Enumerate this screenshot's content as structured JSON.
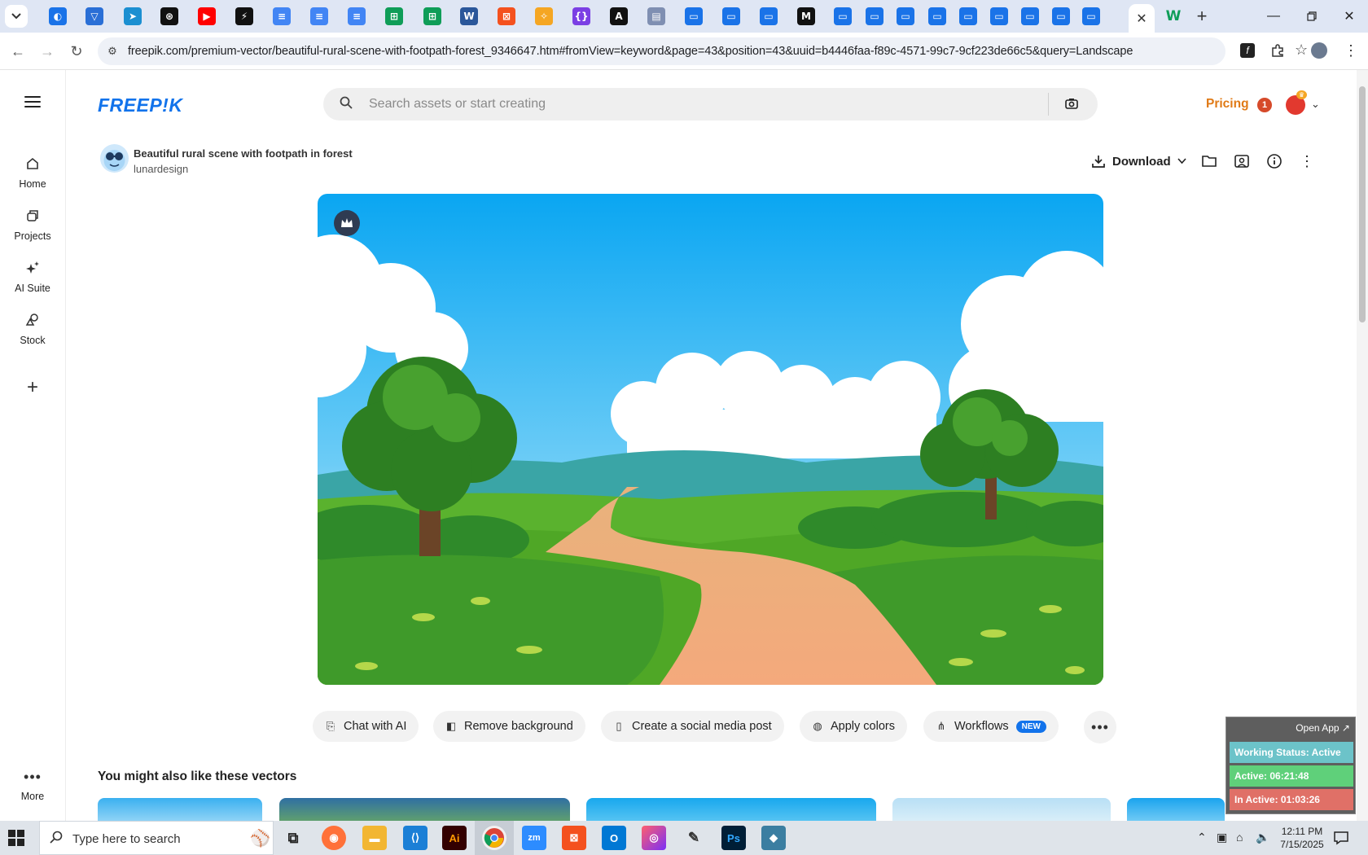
{
  "browser": {
    "tabs": [
      {
        "icon": "tab-search-icon",
        "color": "#1a73e8"
      },
      {
        "icon": "vpn-icon",
        "color": "#2a6fd6"
      },
      {
        "icon": "site-icon",
        "color": "#1b8fd1"
      },
      {
        "icon": "openai-icon",
        "color": "#111111"
      },
      {
        "icon": "youtube-icon",
        "color": "#ff0000"
      },
      {
        "icon": "bolt-icon",
        "color": "#111111"
      },
      {
        "icon": "docs-icon",
        "color": "#4285f4"
      },
      {
        "icon": "docs-icon",
        "color": "#4285f4"
      },
      {
        "icon": "docs-icon",
        "color": "#4285f4"
      },
      {
        "icon": "sheets-icon",
        "color": "#0f9d58"
      },
      {
        "icon": "sheets-icon",
        "color": "#0f9d58"
      },
      {
        "icon": "word-icon",
        "color": "#2b579a"
      },
      {
        "icon": "grid-icon",
        "color": "#f4511e"
      },
      {
        "icon": "vector-icon",
        "color": "#f5a623"
      },
      {
        "icon": "code-icon",
        "color": "#7b3fe4"
      },
      {
        "icon": "a-icon",
        "color": "#111111"
      },
      {
        "icon": "image-icon",
        "color": "#7f8fb2"
      },
      {
        "icon": "forms-icon",
        "color": "#1a73e8"
      },
      {
        "icon": "forms-icon",
        "color": "#1a73e8"
      },
      {
        "icon": "forms-icon",
        "color": "#1a73e8"
      },
      {
        "icon": "m-icon",
        "color": "#111111"
      },
      {
        "icon": "forms-icon",
        "color": "#1a73e8"
      },
      {
        "icon": "forms-icon",
        "color": "#1a73e8"
      },
      {
        "icon": "forms-icon",
        "color": "#1a73e8"
      },
      {
        "icon": "forms-icon",
        "color": "#1a73e8"
      },
      {
        "icon": "forms-icon",
        "color": "#1a73e8"
      },
      {
        "icon": "forms-icon",
        "color": "#1a73e8"
      },
      {
        "icon": "forms-icon",
        "color": "#1a73e8"
      },
      {
        "icon": "forms-icon",
        "color": "#1a73e8"
      },
      {
        "icon": "forms-icon",
        "color": "#1a73e8"
      }
    ],
    "active_tab_close": "✕",
    "url": "freepik.com/premium-vector/beautiful-rural-scene-with-footpath-forest_9346647.htm#fromView=keyword&page=43&position=43&uuid=b4446faa-f89c-4571-99c7-9cf223de66c5&query=Landscape"
  },
  "rail": {
    "items": [
      {
        "label": "Home",
        "icon": "home-icon"
      },
      {
        "label": "Projects",
        "icon": "projects-icon"
      },
      {
        "label": "AI Suite",
        "icon": "sparkles-icon"
      },
      {
        "label": "Stock",
        "icon": "stock-icon"
      }
    ],
    "more_label": "More"
  },
  "header": {
    "logo": "FREEP!K",
    "search_placeholder": "Search assets or start creating",
    "pricing": "Pricing",
    "notification_count": "1"
  },
  "asset": {
    "title": "Beautiful rural scene with footpath in forest",
    "author": "lunardesign",
    "download_label": "Download"
  },
  "actions": {
    "chat_ai": "Chat with AI",
    "remove_bg": "Remove background",
    "social_post": "Create a social media post",
    "apply_colors": "Apply colors",
    "workflows": "Workflows",
    "new_badge": "NEW"
  },
  "related": {
    "title": "You might also like these vectors"
  },
  "tracker": {
    "open_app": "Open App ↗",
    "status": "Working Status: Active",
    "active": "Active: 06:21:48",
    "inactive": "In Active: 01:03:26",
    "colors": {
      "status": "#6cc3c9",
      "active": "#5fd07a",
      "inactive": "#e07067"
    }
  },
  "taskbar": {
    "search_text": "Type here to search",
    "time": "12:11 PM",
    "date": "7/15/2025"
  }
}
